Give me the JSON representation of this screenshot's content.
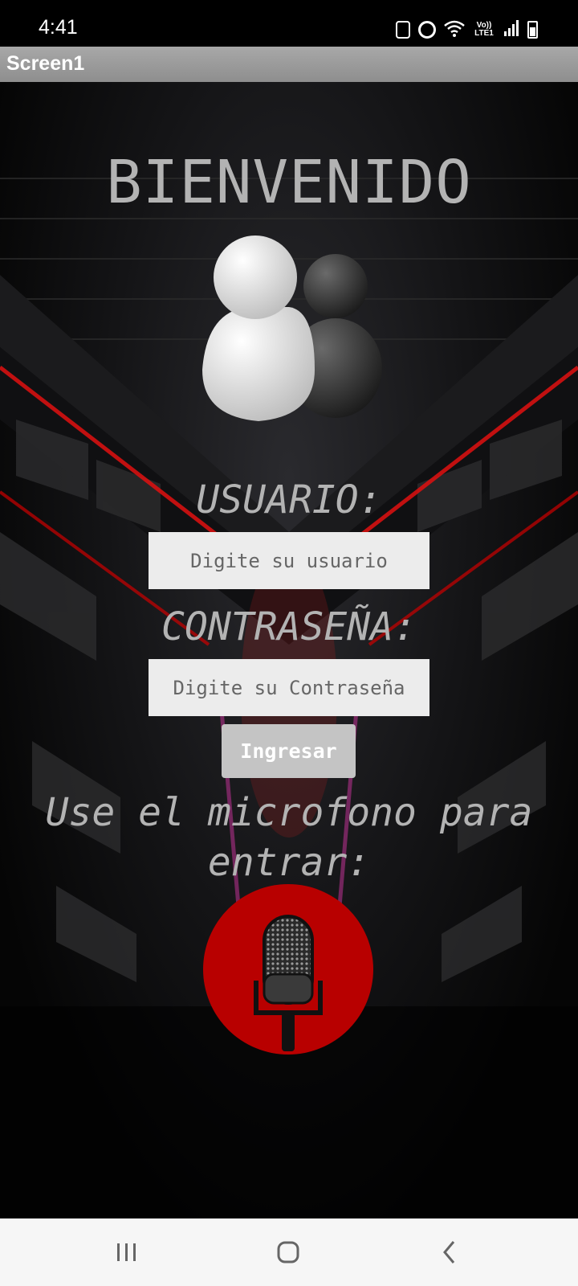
{
  "status_bar": {
    "time": "4:41",
    "network_label": "Vo)) LTE1",
    "icons": [
      "notification-icon",
      "alarm-icon",
      "wifi-icon",
      "volte-icon",
      "signal-icon",
      "battery-icon"
    ]
  },
  "app_bar": {
    "title": "Screen1"
  },
  "main": {
    "welcome": "BIENVENIDO",
    "user_label": "USUARIO:",
    "user_placeholder": "Digite su usuario",
    "password_label": "CONTRASEÑA:",
    "password_placeholder": "Digite su Contraseña",
    "login_button": "Ingresar",
    "mic_prompt_line1": "Use el microfono para",
    "mic_prompt_line2": "entrar:",
    "mic_button_color": "#b80000"
  },
  "nav_bar": {
    "buttons": [
      "recents-icon",
      "home-icon",
      "back-icon"
    ]
  },
  "colors": {
    "title_text": "#b3b3b3",
    "input_bg": "#ececec",
    "button_bg": "#c4c4c4",
    "accent_red": "#b80000"
  }
}
